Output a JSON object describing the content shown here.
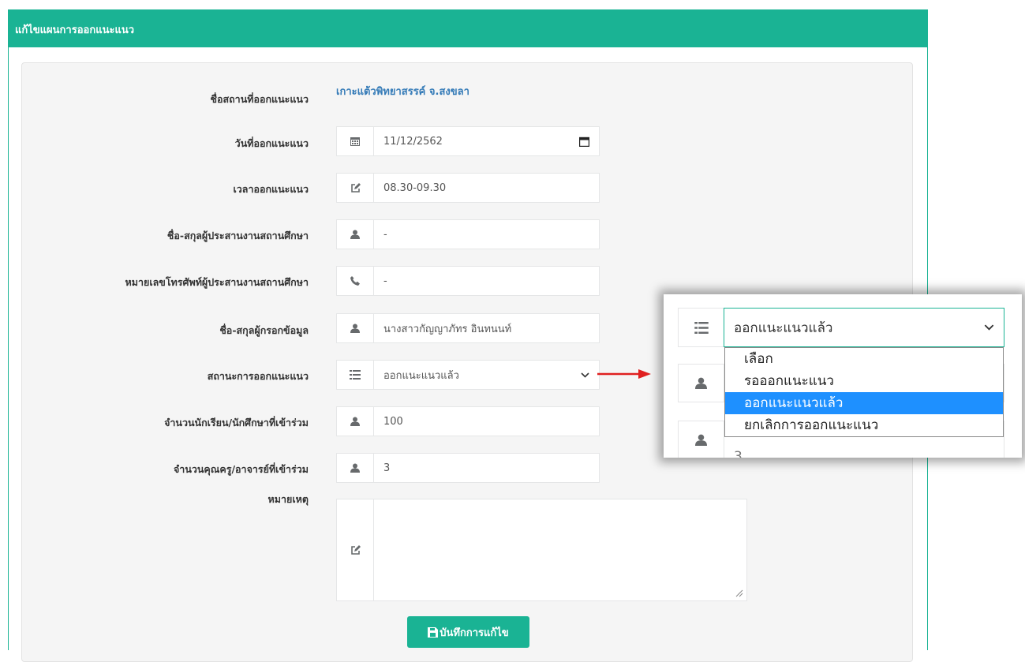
{
  "panel": {
    "title": "แก้ไขแผนการออกแนะแนว"
  },
  "form": {
    "place_label": "ชื่อสถานที่ออกแนะแนว",
    "place_value": "เกาะแต้วพิทยาสรรค์ จ.สงขลา",
    "date_label": "วันที่ออกแนะแนว",
    "date_value": "11/12/2562",
    "time_label": "เวลาออกแนะแนว",
    "time_value": "08.30-09.30",
    "coord_name_label": "ชื่อ-สกุลผู้ประสานงานสถานศึกษา",
    "coord_name_value": "-",
    "coord_phone_label": "หมายเลขโทรศัพท์ผู้ประสานงานสถานศึกษา",
    "coord_phone_value": "-",
    "filler_label": "ชื่อ-สกุลผู้กรอกข้อมูล",
    "filler_value": "นางสาวกัญญาภัทร อินทนนท์",
    "status_label": "สถานะการออกแนะแนว",
    "status_value": "ออกแนะแนวแล้ว",
    "students_label": "จำนวนนักเรียน/นักศึกษาที่เข้าร่วม",
    "students_value": "100",
    "teachers_label": "จำนวนคุณครู/อาจารย์ที่เข้าร่วม",
    "teachers_value": "3",
    "note_label": "หมายเหตุ",
    "note_value": "",
    "save_label": "บันทึกการแก้ไข"
  },
  "zoom": {
    "selected": "ออกแนะแนวแล้ว",
    "options": [
      "เลือก",
      "รอออกแนะแนว",
      "ออกแนะแนวแล้ว",
      "ยกเลิกการออกแนะแนว"
    ],
    "partial_value": "3"
  },
  "colors": {
    "accent": "#1ab394",
    "link": "#337ab7",
    "selection": "#1e90ff",
    "arrow": "#e02020"
  },
  "icons": {
    "date": "calendar-icon",
    "time": "edit-icon",
    "person": "user-icon",
    "phone": "phone-icon",
    "status": "list-icon",
    "dropdown": "chevron-down-icon",
    "save": "save-icon"
  }
}
